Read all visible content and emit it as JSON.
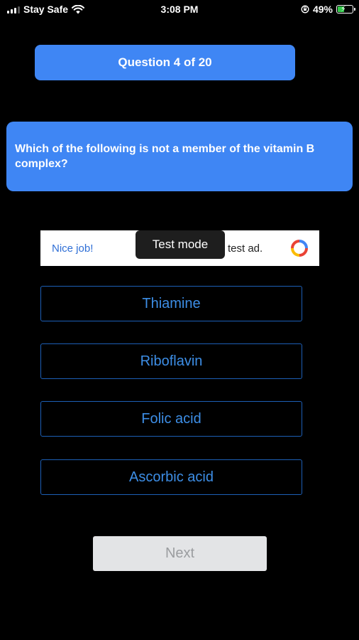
{
  "status_bar": {
    "carrier": "Stay Safe",
    "time": "3:08 PM",
    "battery": "49%",
    "battery_level": 0.49,
    "icons": [
      "signal-icon",
      "wifi-icon",
      "orientation-lock-icon",
      "battery-icon"
    ]
  },
  "quiz": {
    "counter": "Question 4 of 20",
    "question": "Which of the following is not a member of the vitamin B complex?",
    "answers": [
      "Thiamine",
      "Riboflavin",
      "Folic acid",
      "Ascorbic acid"
    ],
    "next_label": "Next"
  },
  "ad": {
    "left_text": "Nice job!",
    "right_text": "test ad.",
    "badge": "Test mode",
    "logo": "ad-network-logo-icon"
  },
  "colors": {
    "accent": "#3f86f4",
    "answer_text": "#3d8ee6",
    "answer_border": "#1d5fb6",
    "battery": "#33c94a"
  }
}
